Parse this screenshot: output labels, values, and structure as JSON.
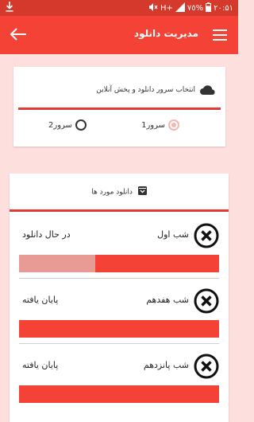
{
  "status_bar": {
    "time": "۲۰:۵۱",
    "battery": "٧٥%",
    "network": "H+",
    "icons": [
      "download-icon",
      "mute-icon",
      "signal-icon",
      "battery-icon"
    ]
  },
  "app_bar": {
    "title": "مدیریت دانلود",
    "back_icon": "arrow-left-icon",
    "menu_icon": "hamburger-menu-icon"
  },
  "server_card": {
    "title": "انتخاب سرور دانلود و پخش آنلاین",
    "options": [
      {
        "label": "سرور1",
        "selected": true
      },
      {
        "label": "سرور2",
        "selected": false
      }
    ]
  },
  "downloads_card": {
    "title": "دانلود مورد ها",
    "items": [
      {
        "name": "شب اول",
        "status": "در حال دانلود",
        "progress": 0.62
      },
      {
        "name": "شب هفدهم",
        "status": "پایان یافته",
        "progress": 1.0
      },
      {
        "name": "شب پانزدهم",
        "status": "پایان یافته",
        "progress": 1.0
      }
    ]
  },
  "colors": {
    "accent": "#f44336",
    "status_bar": "#d5392c",
    "background": "#fde0de",
    "progress_track": "#e89a94"
  }
}
